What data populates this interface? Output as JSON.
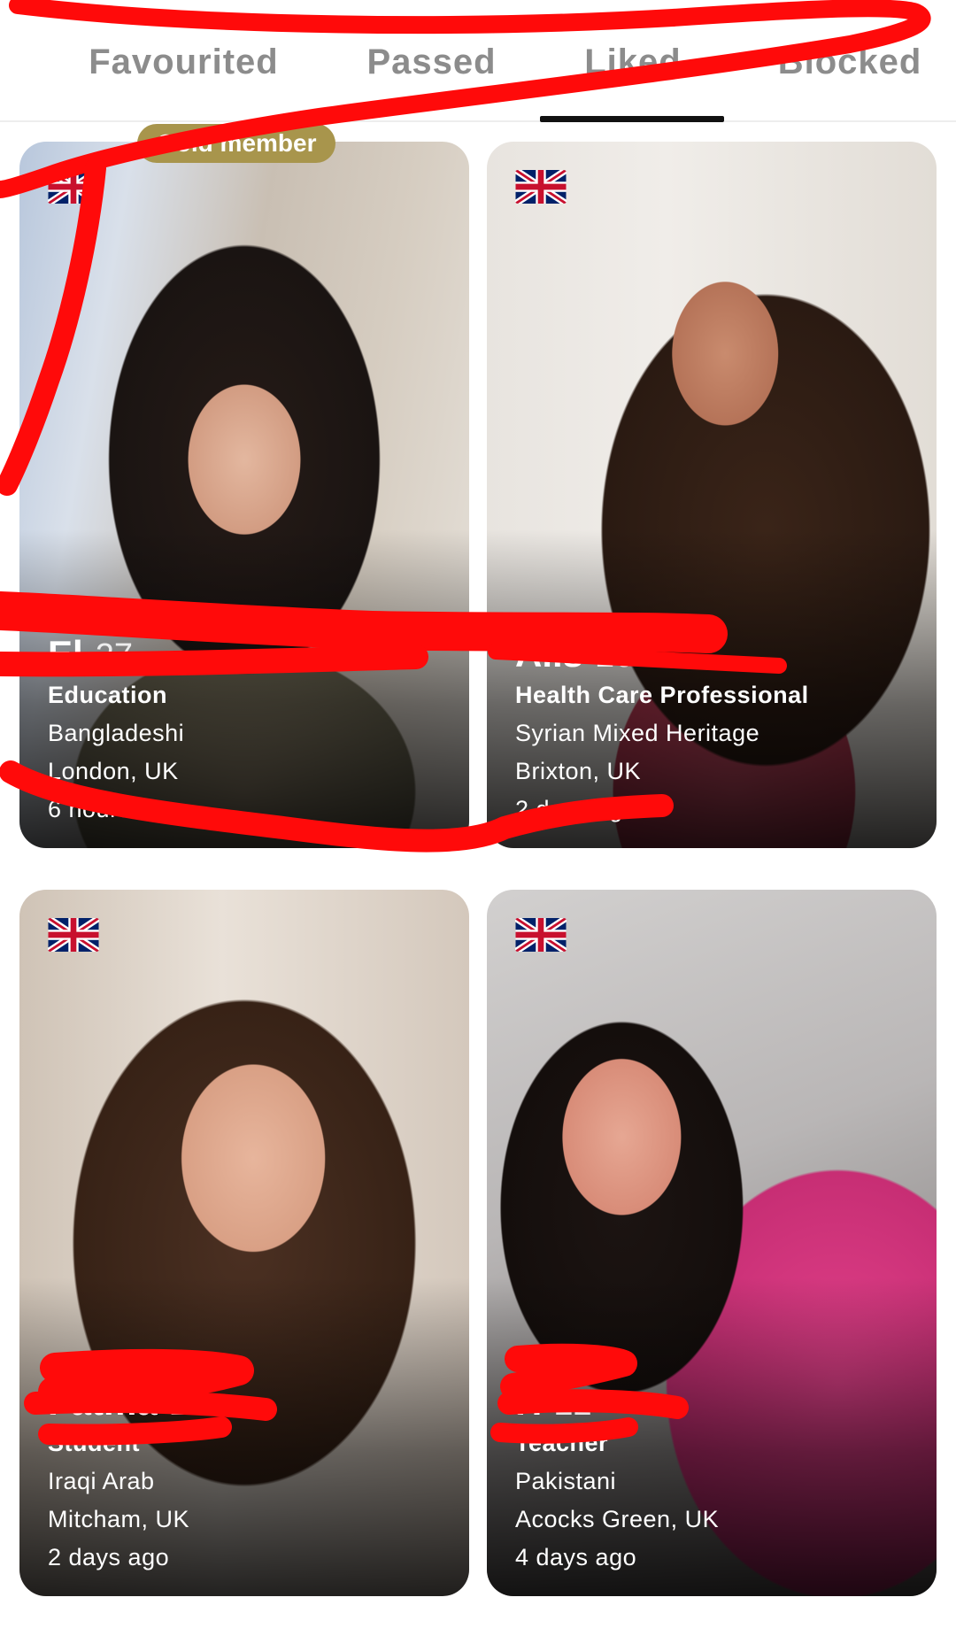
{
  "tabs": {
    "favourited": "Favourited",
    "passed": "Passed",
    "liked": "Liked",
    "blocked": "Blocked",
    "active": "Liked"
  },
  "badge": "Gold member",
  "cards": [
    {
      "flag": "uk-flag-icon",
      "name": "El",
      "age": "27",
      "occupation": "Education",
      "heritage": "Bangladeshi",
      "location": "London, UK",
      "time": "6 hours ago"
    },
    {
      "flag": "uk-flag-icon",
      "name": "Aiis",
      "age": "26",
      "occupation": "Health Care Professional",
      "heritage": "Syrian Mixed Heritage",
      "location": "Brixton, UK",
      "time": "2 days ago"
    },
    {
      "flag": "uk-flag-icon",
      "name": "Fatma",
      "age": "24",
      "occupation": "Student",
      "heritage": "Iraqi Arab",
      "location": "Mitcham, UK",
      "time": "2 days ago"
    },
    {
      "flag": "uk-flag-icon",
      "name": "H",
      "age": "22",
      "occupation": "Teacher",
      "heritage": "Pakistani",
      "location": "Acocks Green, UK",
      "time": "4 days ago"
    }
  ],
  "colors": {
    "redaction": "#ff0a0a",
    "badge": "#a8954c",
    "tab_inactive": "#8c8c8c",
    "tab_indicator": "#111111"
  }
}
